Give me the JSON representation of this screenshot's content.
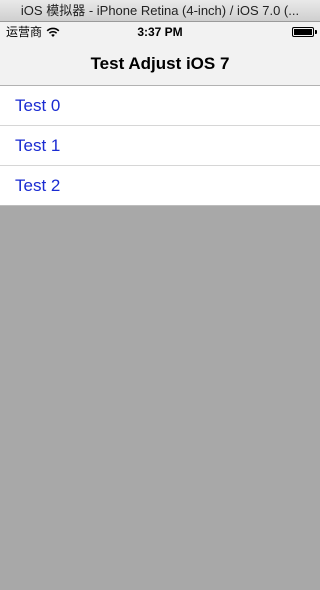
{
  "window": {
    "title": "iOS 模拟器 - iPhone Retina (4-inch) / iOS 7.0 (..."
  },
  "status_bar": {
    "carrier": "运营商",
    "time": "3:37 PM",
    "battery_level": 1.0
  },
  "nav_bar": {
    "title": "Test Adjust iOS 7"
  },
  "table": {
    "rows": [
      {
        "label": "Test 0"
      },
      {
        "label": "Test 1"
      },
      {
        "label": "Test 2"
      }
    ]
  },
  "colors": {
    "cell_text": "#1a2bd2",
    "empty_background": "#a8a8a8",
    "bar_background": "#f2f2f2"
  },
  "icons": {
    "signal": "wifi-icon",
    "battery": "battery-icon"
  }
}
